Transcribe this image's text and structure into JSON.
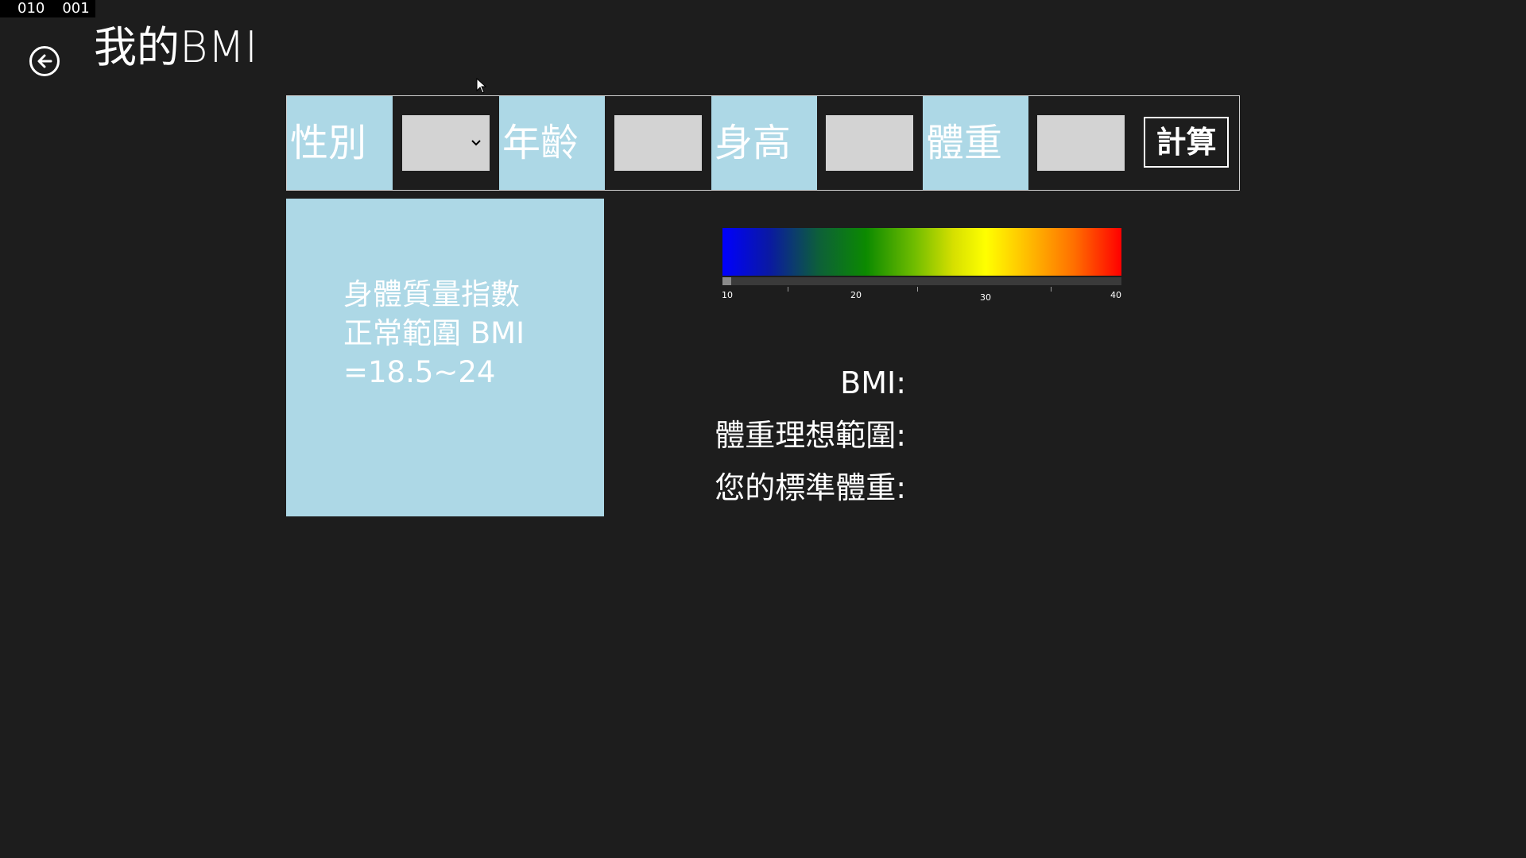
{
  "frame_counter": [
    "010",
    "001"
  ],
  "app": {
    "title": "我的BMI"
  },
  "form": {
    "gender_label": "性別",
    "gender_value": "",
    "age_label": "年齡",
    "age_value": "",
    "height_label": "身高",
    "height_value": "",
    "weight_label": "體重",
    "weight_value": "",
    "calculate_label": "計算"
  },
  "info": {
    "lines": [
      "身體質量指數",
      "正常範圍 BMI",
      "=18.5~24"
    ]
  },
  "scale": {
    "min": 10,
    "max": 40,
    "labels": [
      "10",
      "20",
      "30",
      "40"
    ],
    "current_value": 10
  },
  "results": {
    "bmi_label": "BMI:",
    "ideal_range_label": "體重理想範圍:",
    "standard_weight_label": "您的標準體重:"
  },
  "icons": {
    "back": "back-arrow-icon",
    "dropdown": "chevron-down-icon",
    "cursor": "mouse-cursor-icon"
  },
  "colors": {
    "background": "#1d1d1d",
    "accent": "#add8e6",
    "input": "#d3d3d3"
  }
}
